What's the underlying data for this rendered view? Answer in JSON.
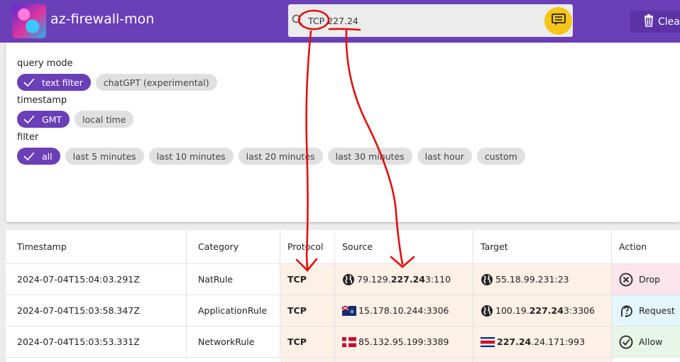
{
  "app": {
    "title": "az-firewall-mon"
  },
  "search": {
    "value": "TCP 227.24",
    "icon": "search-icon",
    "button_icon": "chat-filter-icon"
  },
  "clear_button": {
    "label": "Clea",
    "icon": "trash-icon"
  },
  "filters": {
    "query_mode": {
      "label": "query mode",
      "options": [
        "text filter",
        "chatGPT (experimental)"
      ],
      "selected": "text filter"
    },
    "timestamp": {
      "label": "timestamp",
      "options": [
        "GMT",
        "local time"
      ],
      "selected": "GMT"
    },
    "filter": {
      "label": "filter",
      "options": [
        "all",
        "last 5 minutes",
        "last 10 minutes",
        "last 20 minutes",
        "last 30 minutes",
        "last hour",
        "custom"
      ],
      "selected": "all"
    }
  },
  "table": {
    "columns": [
      "Timestamp",
      "Category",
      "Protocol",
      "Source",
      "Target",
      "Action"
    ],
    "rows": [
      {
        "timestamp": "2024-07-04T15:04:03.291Z",
        "category": "NatRule",
        "protocol": "TCP",
        "source": {
          "icon": "globe-icon",
          "pre": "79.129.",
          "match": "227.24",
          "post": "3:110"
        },
        "target": {
          "icon": "globe-icon",
          "pre": "55.18.99.231:23",
          "match": "",
          "post": ""
        },
        "action": {
          "label": "Drop",
          "icon": "x-circle-icon"
        }
      },
      {
        "timestamp": "2024-07-04T15:03:58.347Z",
        "category": "ApplicationRule",
        "protocol": "TCP",
        "source": {
          "icon": "falkland-flag-icon",
          "pre": "15.178.10.244:3306",
          "match": "",
          "post": ""
        },
        "target": {
          "icon": "globe-icon",
          "pre": "100.19.",
          "match": "227.24",
          "post": "3:3306"
        },
        "action": {
          "label": "Request",
          "icon": "question-head-icon"
        }
      },
      {
        "timestamp": "2024-07-04T15:03:53.331Z",
        "category": "NetworkRule",
        "protocol": "TCP",
        "source": {
          "icon": "denmark-flag-icon",
          "pre": "85.132.95.199:3389",
          "match": "",
          "post": ""
        },
        "target": {
          "icon": "costa-rica-flag-icon",
          "pre": "",
          "match": "227.24",
          "post": ".24.171:993"
        },
        "action": {
          "label": "Allow",
          "icon": "check-circle-icon"
        }
      }
    ]
  },
  "colors": {
    "appbar": "#6a3fb8",
    "chip_selected": "#6a3fb8",
    "search_button": "#f5c518",
    "annotation": "#e01010"
  }
}
